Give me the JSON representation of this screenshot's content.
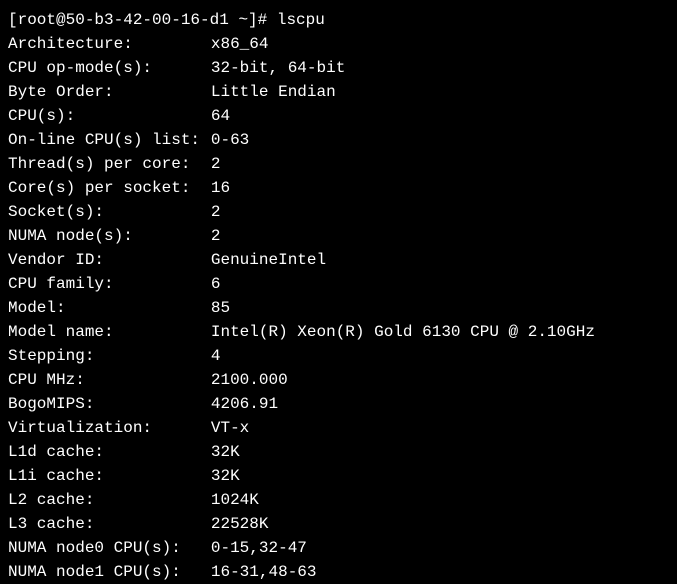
{
  "prompt": "[root@50-b3-42-00-16-d1 ~]# ",
  "command": "lscpu",
  "rows": [
    {
      "label": "Architecture:",
      "value": "x86_64"
    },
    {
      "label": "CPU op-mode(s):",
      "value": "32-bit, 64-bit"
    },
    {
      "label": "Byte Order:",
      "value": "Little Endian"
    },
    {
      "label": "CPU(s):",
      "value": "64"
    },
    {
      "label": "On-line CPU(s) list:",
      "value": "0-63"
    },
    {
      "label": "Thread(s) per core:",
      "value": "2"
    },
    {
      "label": "Core(s) per socket:",
      "value": "16"
    },
    {
      "label": "Socket(s):",
      "value": "2"
    },
    {
      "label": "NUMA node(s):",
      "value": "2"
    },
    {
      "label": "Vendor ID:",
      "value": "GenuineIntel"
    },
    {
      "label": "CPU family:",
      "value": "6"
    },
    {
      "label": "Model:",
      "value": "85"
    },
    {
      "label": "Model name:",
      "value": "Intel(R) Xeon(R) Gold 6130 CPU @ 2.10GHz"
    },
    {
      "label": "Stepping:",
      "value": "4"
    },
    {
      "label": "CPU MHz:",
      "value": "2100.000"
    },
    {
      "label": "BogoMIPS:",
      "value": "4206.91"
    },
    {
      "label": "Virtualization:",
      "value": "VT-x"
    },
    {
      "label": "L1d cache:",
      "value": "32K"
    },
    {
      "label": "L1i cache:",
      "value": "32K"
    },
    {
      "label": "L2 cache:",
      "value": "1024K"
    },
    {
      "label": "L3 cache:",
      "value": "22528K"
    },
    {
      "label": "NUMA node0 CPU(s):",
      "value": "0-15,32-47"
    },
    {
      "label": "NUMA node1 CPU(s):",
      "value": "16-31,48-63"
    }
  ]
}
